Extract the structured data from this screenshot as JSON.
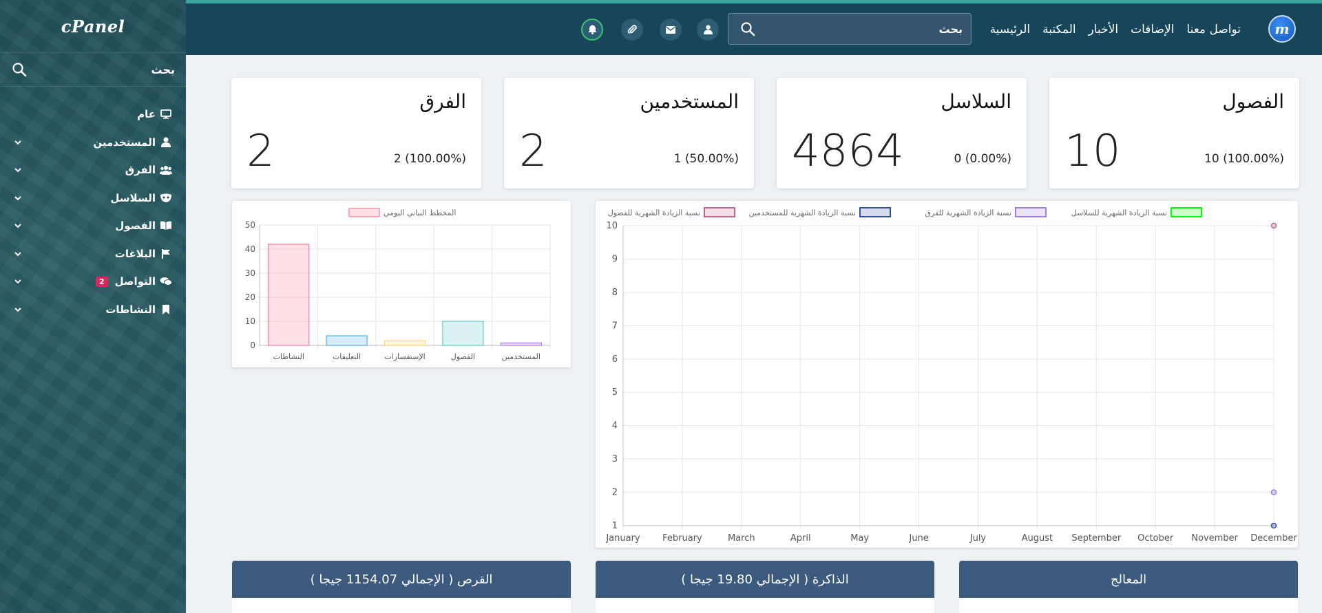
{
  "sidebar": {
    "brand": "cPanel",
    "search_label": "بحث",
    "items": [
      {
        "label": "عام",
        "icon": "monitor-icon"
      },
      {
        "label": "المستخدمين",
        "icon": "user-icon"
      },
      {
        "label": "الفرق",
        "icon": "users-icon"
      },
      {
        "label": "السلاسل",
        "icon": "mask-icon"
      },
      {
        "label": "الفصول",
        "icon": "book-icon"
      },
      {
        "label": "البلاغات",
        "icon": "flag-icon"
      },
      {
        "label": "التواصل",
        "icon": "comments-icon",
        "badge": "2"
      },
      {
        "label": "النشاطات",
        "icon": "bookmark-icon"
      }
    ]
  },
  "topbar": {
    "logo_letter": "m",
    "nav": [
      "الرئيسية",
      "المكتبة",
      "الأخبار",
      "الإضافات",
      "تواصل معنا"
    ],
    "search_placeholder": "بحث",
    "icons": [
      "user-icon",
      "envelope-icon",
      "paperclip-icon",
      "bell-icon"
    ],
    "accent": "#3aa6a0"
  },
  "stats": [
    {
      "title": "الفصول",
      "value": "10",
      "sub": "10 (100.00%)"
    },
    {
      "title": "السلاسل",
      "value": "4864",
      "sub": "0 (0.00%)"
    },
    {
      "title": "المستخدمين",
      "value": "2",
      "sub": "1 (50.00%)"
    },
    {
      "title": "الفرق",
      "value": "2",
      "sub": "2 (100.00%)"
    }
  ],
  "chart_data": [
    {
      "type": "bar",
      "legend": [
        "المخطط البياني اليومي"
      ],
      "categories": [
        "النشاطات",
        "التعليقات",
        "الإستفسارات",
        "الفصول",
        "المستخدمين"
      ],
      "values": [
        42,
        4,
        2,
        10,
        1
      ],
      "colors": [
        "#ff6384",
        "#36a2eb",
        "#ffce56",
        "#4bc0c0",
        "#9966ff"
      ],
      "ylim": [
        0,
        50
      ],
      "yticks": [
        0,
        10,
        20,
        30,
        40,
        50
      ],
      "grid": true
    },
    {
      "type": "line",
      "legend_position": "top",
      "categories": [
        "January",
        "February",
        "March",
        "April",
        "May",
        "June",
        "July",
        "August",
        "September",
        "October",
        "November",
        "December"
      ],
      "series": [
        {
          "name": "نسبة الزيادة الشهرية للسلاسل",
          "color": "#00ff00",
          "values": [
            null,
            null,
            null,
            null,
            null,
            null,
            null,
            null,
            null,
            null,
            null,
            null
          ]
        },
        {
          "name": "نسبة الزيادة الشهرية للفرق",
          "color": "#9c7fe0",
          "values": [
            null,
            null,
            null,
            null,
            null,
            null,
            null,
            null,
            null,
            null,
            null,
            2
          ]
        },
        {
          "name": "نسبة الزيادة الشهرية للمستخدمين",
          "color": "#2f4f9a",
          "values": [
            null,
            null,
            null,
            null,
            null,
            null,
            null,
            null,
            null,
            null,
            null,
            1
          ]
        },
        {
          "name": "نسبة الزيادة الشهرية للفصول",
          "color": "#c0628f",
          "values": [
            null,
            null,
            null,
            null,
            null,
            null,
            null,
            null,
            null,
            null,
            null,
            10
          ]
        }
      ],
      "ylim": [
        1,
        10
      ],
      "yticks": [
        1,
        2,
        3,
        4,
        5,
        6,
        7,
        8,
        9,
        10
      ],
      "grid": true
    }
  ],
  "bottom_headers": [
    "المعالج",
    "الذاكرة ( الإجمالي 19.80 جيجا )",
    "القرص ( الإجمالي 1154.07 جيجا )"
  ]
}
